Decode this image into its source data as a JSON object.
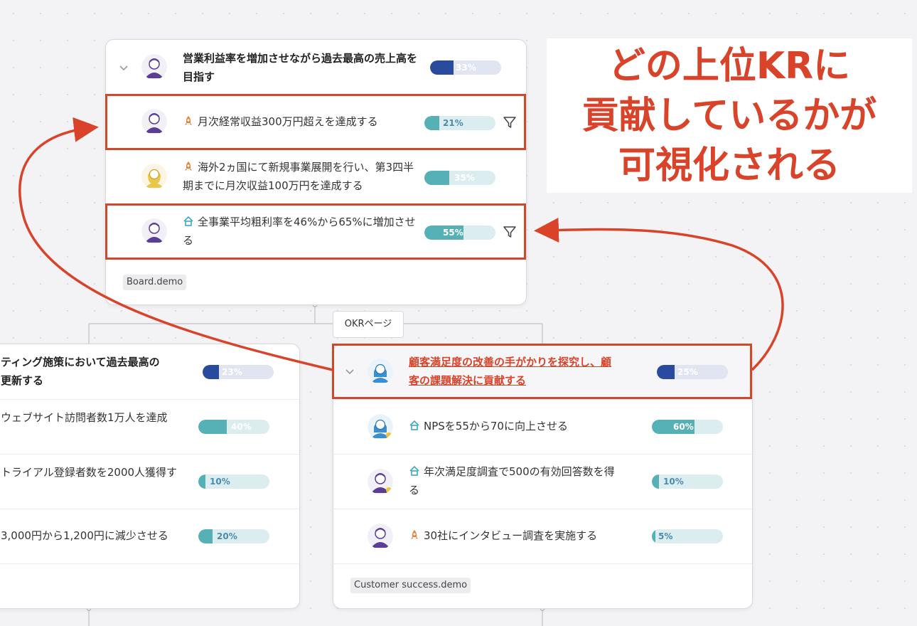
{
  "top_card": {
    "objective": {
      "title": "営業利益率を増加させながら過去最高の売上高を目指す",
      "progress": 33,
      "progress_label": "33%"
    },
    "key_results": [
      {
        "icon": "rocket-icon",
        "title": "月次経常収益300万円超えを達成する",
        "progress": 21,
        "progress_label": "21%",
        "highlighted": true,
        "filter": true
      },
      {
        "icon": "rocket-icon",
        "title": "海外2ヵ国にて新規事業展開を行い、第3四半期までに月次収益100万円を達成する",
        "progress": 35,
        "progress_label": "35%",
        "highlighted": false,
        "filter": false
      },
      {
        "icon": "house-icon",
        "title": "全事業平均粗利率を46%から65%に増加させる",
        "progress": 55,
        "progress_label": "55%",
        "highlighted": true,
        "filter": true
      }
    ],
    "team_tag": "Board.demo"
  },
  "okr_page_label": "OKRページ",
  "left_card": {
    "objective": {
      "title": "ティング施策において過去最高の 更新する",
      "line1": "ティング施策において過去最高の",
      "line2": "更新する",
      "progress": 23,
      "progress_label": "23%"
    },
    "key_results": [
      {
        "title": "ウェブサイト訪問者数1万人を達成",
        "progress": 40,
        "progress_label": "40%"
      },
      {
        "title": "トライアル登録者数を2000人獲得す",
        "progress": 10,
        "progress_label": "10%"
      },
      {
        "title": "3,000円から1,200円に減少させる",
        "progress": 20,
        "progress_label": "20%"
      }
    ]
  },
  "right_card": {
    "objective": {
      "title": "顧客満足度の改善の手がかりを探究し、顧客の課題解決に貢献する",
      "line1": "顧客満足度の改善の手がかりを探究し、顧",
      "line2": "客の課題解決に貢献する",
      "progress": 25,
      "progress_label": "25%"
    },
    "key_results": [
      {
        "icon": "house-icon",
        "title": "NPSを55から70に向上させる",
        "progress": 60,
        "progress_label": "60%"
      },
      {
        "icon": "house-icon",
        "title": "年次満足度調査で500の有効回答数を得る",
        "line1": "年次満足度調査で500の有効回答数を得",
        "line2": "る",
        "progress": 10,
        "progress_label": "10%"
      },
      {
        "icon": "rocket-icon",
        "title": "30社にインタビュー調査を実施する",
        "progress": 5,
        "progress_label": "5%"
      }
    ],
    "team_tag": "Customer success.demo"
  },
  "callout": {
    "lines": [
      "どの上位KRに",
      "貢献しているかが",
      "可視化される"
    ],
    "color": "#d9432a"
  },
  "colors": {
    "objective_bar": "#2a4a9e",
    "kr_bar": "#56b1b7",
    "highlight": "#cc4a2a"
  }
}
